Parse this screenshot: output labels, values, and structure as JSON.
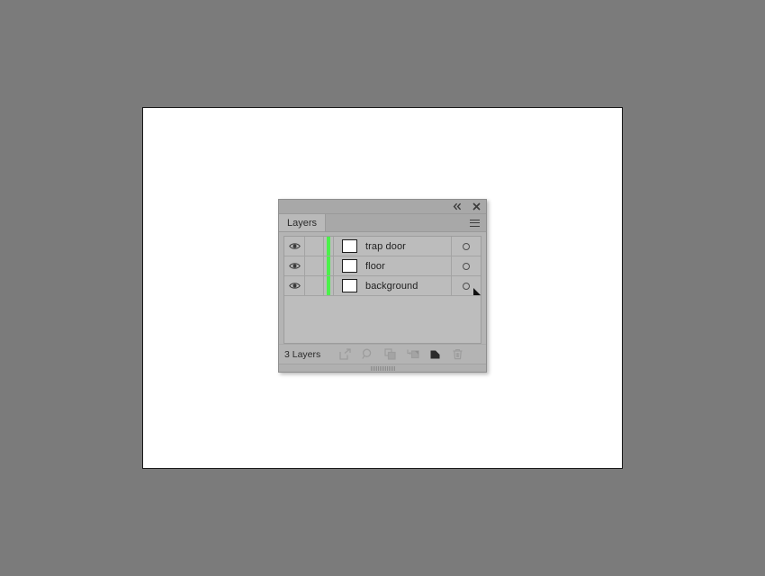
{
  "workspace": {
    "background_color": "#7b7b7b",
    "canvas_color": "#ffffff"
  },
  "panel": {
    "title": "Layers",
    "titlebar": {
      "collapse_icon": "double-chevron-left-icon",
      "close_icon": "close-icon"
    },
    "menu_icon": "panel-menu-icon",
    "columns": {
      "visibility": "Visibility",
      "lock": "Lock",
      "color": "Layer Color",
      "thumbnail": "Thumbnail",
      "name": "Name",
      "target": "Target"
    },
    "layers": [
      {
        "name": "trap door",
        "visible": true,
        "locked": false,
        "color": "#4bf04b",
        "thumbnail_color": "#ffffff",
        "targeted": false
      },
      {
        "name": "floor",
        "visible": true,
        "locked": false,
        "color": "#4bf04b",
        "thumbnail_color": "#ffffff",
        "targeted": false
      },
      {
        "name": "background",
        "visible": true,
        "locked": false,
        "color": "#4bf04b",
        "thumbnail_color": "#ffffff",
        "targeted": false,
        "selected": true
      }
    ],
    "footer": {
      "layer_count_label": "3 Layers",
      "buttons": [
        {
          "name": "make-clipping-mask",
          "icon": "clipping-mask-icon"
        },
        {
          "name": "locate-object",
          "icon": "magnifier-icon"
        },
        {
          "name": "create-new-sublayer",
          "icon": "new-sublayer-icon"
        },
        {
          "name": "create-new-layer-below",
          "icon": "layer-arrow-icon"
        },
        {
          "name": "create-new-layer",
          "icon": "new-layer-icon"
        },
        {
          "name": "delete-selection",
          "icon": "trash-icon"
        }
      ]
    }
  }
}
